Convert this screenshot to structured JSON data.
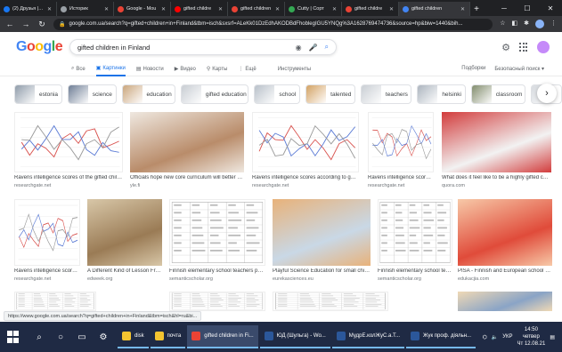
{
  "browser": {
    "tabs": [
      {
        "label": "(2) Друзья | Fa",
        "color": "#1877f2"
      },
      {
        "label": "Историк",
        "color": "#9aa0a6"
      },
      {
        "label": "Google - Mou",
        "color": "#ea4335"
      },
      {
        "label": "gifted childre",
        "color": "#ff0000"
      },
      {
        "label": "gifted children",
        "color": "#ea4335"
      },
      {
        "label": "Cutty | Сорт",
        "color": "#34a853"
      },
      {
        "label": "gifted childre",
        "color": "#ea4335"
      },
      {
        "label": "gifted children",
        "color": "#4285f4",
        "active": true
      }
    ],
    "new_tab": "+",
    "url": "google.com.ua/search?q=gifted+children+in+Finland&tbm=isch&sxsrf=ALeKk01DzEdhAKODBdFhoblegIGU5YNQg%3A1628769474736&source=hp&biw=1440&bih..."
  },
  "google": {
    "logo": [
      "G",
      "o",
      "o",
      "g",
      "l",
      "e"
    ],
    "query": "gifted children in Finland",
    "tabs": [
      {
        "label": "Все",
        "icon": "search-icon",
        "glyph": "⌕"
      },
      {
        "label": "Картинки",
        "icon": "image-icon",
        "glyph": "▣",
        "active": true
      },
      {
        "label": "Новости",
        "icon": "news-icon",
        "glyph": "▤"
      },
      {
        "label": "Видео",
        "icon": "video-icon",
        "glyph": "▶"
      },
      {
        "label": "Карты",
        "icon": "map-pin-icon",
        "glyph": "⚲"
      },
      {
        "label": "Ещё",
        "icon": "more-icon",
        "glyph": "⋮"
      }
    ],
    "tools": "Инструменты",
    "right_links": [
      "Подборки",
      "Безопасный поиск ▾"
    ]
  },
  "chips": [
    {
      "label": "estonia",
      "color": "#8d9aa8"
    },
    {
      "label": "science",
      "color": "#6b7b93"
    },
    {
      "label": "education",
      "color": "#c9a47a"
    },
    {
      "label": "gifted education",
      "color": "#c7ccd2"
    },
    {
      "label": "school",
      "color": "#b7bfc8"
    },
    {
      "label": "talented",
      "color": "#d2a060"
    },
    {
      "label": "teachers",
      "color": "#c8cdd3"
    },
    {
      "label": "helsinki",
      "color": "#aab3bd"
    },
    {
      "label": "classroom",
      "color": "#7f8a6a"
    },
    {
      "label": "",
      "color": "#d5d9de"
    }
  ],
  "results": [
    {
      "caption": "Ravens intelligence scores of the gifted childre...",
      "source": "researchgate.net",
      "kind": "chart"
    },
    {
      "caption": "Officials hope new core curriculum will better caf...",
      "source": "yle.fi",
      "kind": "photo",
      "bg": "#b98c6a",
      "bg2": "#efe8e0"
    },
    {
      "caption": "Ravens intelligence scores according to gender...",
      "source": "researchgate.net",
      "kind": "chart"
    },
    {
      "caption": "Ravens intelligence scores ...",
      "source": "researchgate.net",
      "kind": "chart"
    },
    {
      "caption": "What does it feel like to be a highly gifted child in...",
      "source": "quora.com",
      "kind": "photo",
      "bg": "#f2f2f2",
      "bg2": "#d23c3c"
    },
    {
      "caption": "Ravens intelligence scores ...",
      "source": "researchgate.net",
      "kind": "chart"
    },
    {
      "caption": "A Different Kind of Lesson Fro...",
      "source": "edweek.org",
      "kind": "photo",
      "bg": "#9a7b55",
      "bg2": "#d8c7a8"
    },
    {
      "caption": "Finnish elementary school teachers pers...",
      "source": "semanticscholar.org",
      "kind": "table"
    },
    {
      "caption": "Playful Science Education for small childr...",
      "source": "eurekasciences.eu",
      "kind": "photo",
      "bg": "#c9d8e6",
      "bg2": "#e8b27a"
    },
    {
      "caption": "Finnish elementary school tea...",
      "source": "semanticscholar.org",
      "kind": "table"
    },
    {
      "caption": "PISA - Finnish and European school syste...",
      "source": "edukacjia.com",
      "kind": "photo",
      "bg": "#e04b3a",
      "bg2": "#f7c9a8"
    },
    {
      "caption": "",
      "source": "",
      "kind": "table"
    },
    {
      "caption": "",
      "source": "",
      "kind": "table"
    },
    {
      "caption": "",
      "source": "",
      "kind": "table"
    },
    {
      "caption": "",
      "source": "",
      "kind": "photo",
      "bg": "#8aa4c6",
      "bg2": "#f0d9b5"
    }
  ],
  "status_url": "https://www.google.com.ua/search?q=gifted+children+in+Finland&tbm=isch&hl=ru&bi...",
  "taskbar": {
    "apps": [
      {
        "label": "disk",
        "color": "#f4c430"
      },
      {
        "label": "почта",
        "color": "#f4c430"
      },
      {
        "label": "gifted children in Fi...",
        "color": "#ea4335",
        "active": true
      },
      {
        "label": "ЮД (Шульга) - Wo...",
        "color": "#2b579a"
      },
      {
        "label": "МудрЕ.колЖуС.а.Т...",
        "color": "#2b579a"
      },
      {
        "label": "Жук проф. діяльн...",
        "color": "#2b579a"
      }
    ],
    "lang": "УКР",
    "time": "14:50",
    "day": "четвер",
    "date": "Чт 12.08.21"
  }
}
